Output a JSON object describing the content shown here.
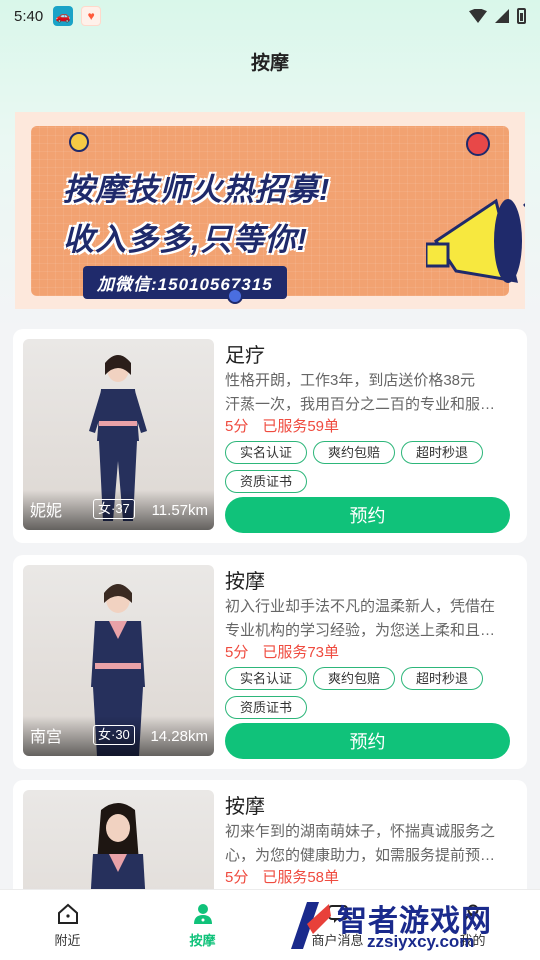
{
  "status_bar": {
    "time": "5:40"
  },
  "header": {
    "title": "按摩"
  },
  "banner": {
    "line1": "按摩技师火热招募!",
    "line2": "收入多多,只等你!",
    "wechat": "加微信:15010567315"
  },
  "cards": [
    {
      "title": "足疗",
      "desc_line1": "性格开朗，工作3年，到店送价格38元",
      "desc_line2": "汗蒸一次，我用百分之二百的专业和服…",
      "score": "5分",
      "served": "已服务59单",
      "name": "妮妮",
      "gender_age": "女·37",
      "distance": "11.57km",
      "tags": [
        "实名认证",
        "爽约包赔",
        "超时秒退",
        "资质证书"
      ],
      "book_label": "预约"
    },
    {
      "title": "按摩",
      "desc_line1": "初入行业却手法不凡的温柔新人，凭借在",
      "desc_line2": "专业机构的学习经验，为您送上柔和且…",
      "score": "5分",
      "served": "已服务73单",
      "name": "南宫",
      "gender_age": "女·30",
      "distance": "14.28km",
      "tags": [
        "实名认证",
        "爽约包赔",
        "超时秒退",
        "资质证书"
      ],
      "book_label": "预约"
    },
    {
      "title": "按摩",
      "desc_line1": "初来乍到的湖南萌妹子，怀揣真诚服务之",
      "desc_line2": "心，为您的健康助力，如需服务提前预…",
      "score": "5分",
      "served": "已服务58单",
      "name": "",
      "gender_age": "",
      "distance": "",
      "tags": [],
      "book_label": ""
    }
  ],
  "bottom_nav": [
    {
      "label": "附近",
      "icon": "home-icon"
    },
    {
      "label": "按摩",
      "icon": "person-icon",
      "active": true
    },
    {
      "label": "商户消息",
      "icon": "message-icon"
    },
    {
      "label": "我的",
      "icon": "user-icon"
    }
  ],
  "watermark": {
    "text": "智者游戏网",
    "url": "zzsiyxcy.com"
  },
  "colors": {
    "accent": "#10c27a",
    "price_red": "#ef4b3f",
    "banner_navy": "#1f2a6b"
  }
}
